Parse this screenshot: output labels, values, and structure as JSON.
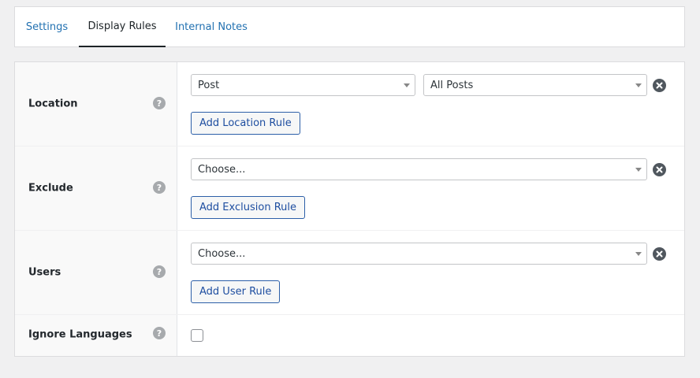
{
  "tabs": [
    {
      "label": "Settings"
    },
    {
      "label": "Display Rules"
    },
    {
      "label": "Internal Notes"
    }
  ],
  "rows": {
    "location": {
      "label": "Location",
      "select_primary": "Post",
      "select_secondary": "All Posts",
      "button": "Add Location Rule"
    },
    "exclude": {
      "label": "Exclude",
      "select": "Choose...",
      "button": "Add Exclusion Rule"
    },
    "users": {
      "label": "Users",
      "select": "Choose...",
      "button": "Add User Rule"
    },
    "ignore_languages": {
      "label": "Ignore Languages",
      "checked": false
    }
  },
  "help_glyph": "?",
  "icons": {
    "help": "question-circle-icon",
    "remove": "close-circle-icon",
    "dropdown": "chevron-down-icon"
  }
}
